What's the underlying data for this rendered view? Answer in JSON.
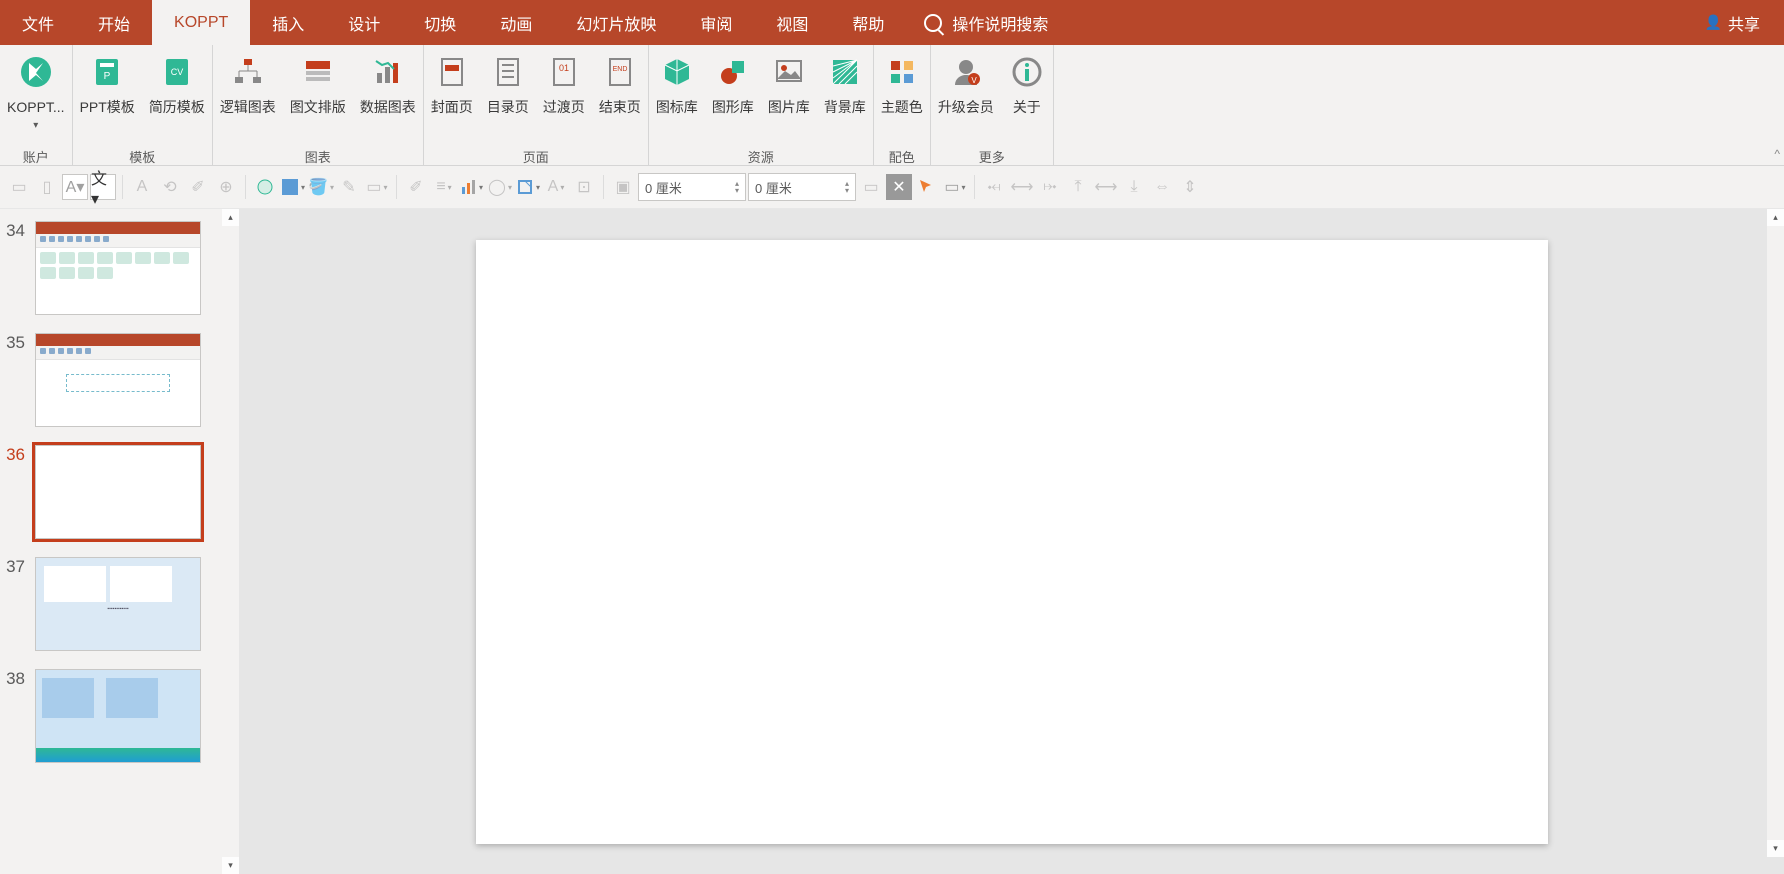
{
  "menubar": {
    "tabs": [
      "文件",
      "开始",
      "KOPPT",
      "插入",
      "设计",
      "切换",
      "动画",
      "幻灯片放映",
      "审阅",
      "视图",
      "帮助"
    ],
    "active": 2,
    "search_placeholder": "操作说明搜索",
    "share_label": "共享"
  },
  "ribbon": {
    "groups": [
      {
        "label": "账户",
        "buttons": [
          {
            "label": "KOPPT...",
            "icon": "koppt",
            "caret": true
          }
        ]
      },
      {
        "label": "模板",
        "buttons": [
          {
            "label": "PPT模板",
            "icon": "ppt-tpl"
          },
          {
            "label": "简历模板",
            "icon": "cv-tpl"
          }
        ]
      },
      {
        "label": "图表",
        "buttons": [
          {
            "label": "逻辑图表",
            "icon": "logic"
          },
          {
            "label": "图文排版",
            "icon": "layout"
          },
          {
            "label": "数据图表",
            "icon": "data"
          }
        ]
      },
      {
        "label": "页面",
        "buttons": [
          {
            "label": "封面页",
            "icon": "cover"
          },
          {
            "label": "目录页",
            "icon": "toc"
          },
          {
            "label": "过渡页",
            "icon": "trans"
          },
          {
            "label": "结束页",
            "icon": "end"
          }
        ]
      },
      {
        "label": "资源",
        "buttons": [
          {
            "label": "图标库",
            "icon": "iconlib"
          },
          {
            "label": "图形库",
            "icon": "shapelib"
          },
          {
            "label": "图片库",
            "icon": "imglib"
          },
          {
            "label": "背景库",
            "icon": "bglib"
          }
        ]
      },
      {
        "label": "配色",
        "buttons": [
          {
            "label": "主题色",
            "icon": "theme"
          }
        ]
      },
      {
        "label": "更多",
        "buttons": [
          {
            "label": "升级会员",
            "icon": "vip"
          },
          {
            "label": "关于",
            "icon": "info"
          }
        ]
      }
    ]
  },
  "toolbar2": {
    "size1": "0 厘米",
    "size2": "0 厘米"
  },
  "slides": [
    {
      "num": "34",
      "type": "icons",
      "active": false
    },
    {
      "num": "35",
      "type": "flow",
      "active": false
    },
    {
      "num": "36",
      "type": "blank",
      "active": true
    },
    {
      "num": "37",
      "type": "chart",
      "active": false
    },
    {
      "num": "38",
      "type": "blue",
      "active": false
    }
  ]
}
